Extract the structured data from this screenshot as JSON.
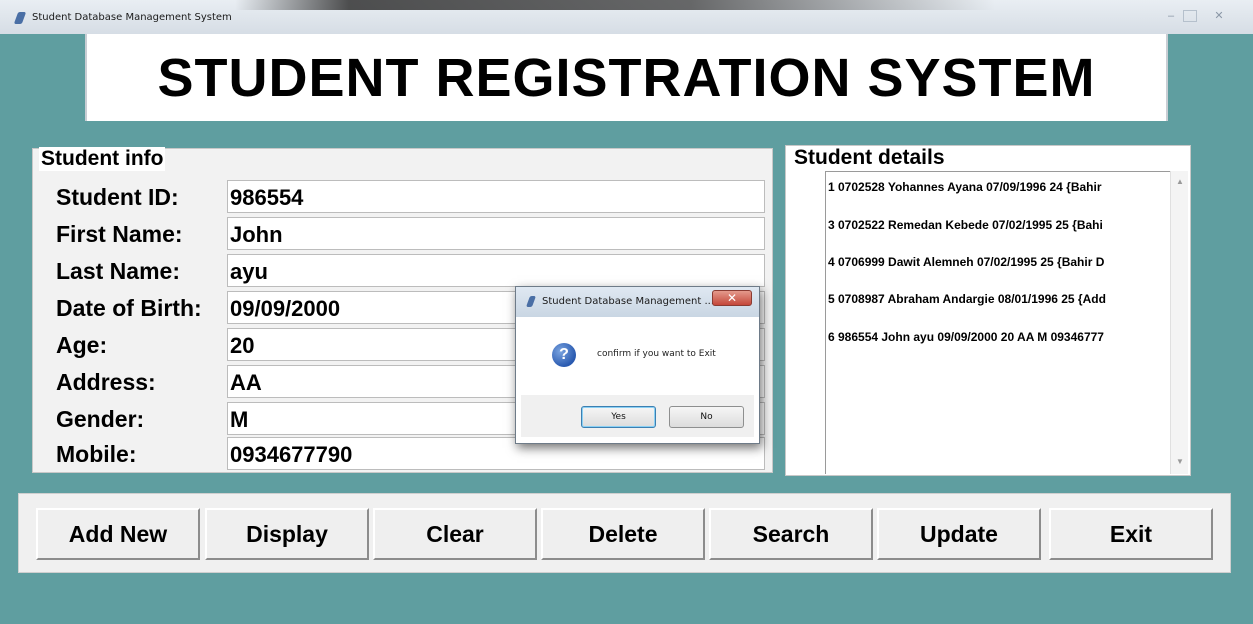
{
  "window": {
    "title": "Student Database Management System",
    "minimize": "–",
    "maximize": "▫",
    "close": "✕"
  },
  "banner": {
    "title": "STUDENT REGISTRATION SYSTEM"
  },
  "student_info": {
    "label": "Student info",
    "fields": [
      {
        "label": "Student ID:",
        "value": "986554"
      },
      {
        "label": "First Name:",
        "value": "John"
      },
      {
        "label": "Last Name:",
        "value": "ayu"
      },
      {
        "label": "Date of Birth:",
        "value": "09/09/2000"
      },
      {
        "label": "Age:",
        "value": "20"
      },
      {
        "label": "Address:",
        "value": "AA"
      },
      {
        "label": "Gender:",
        "value": "M"
      },
      {
        "label": "Mobile:",
        "value": "0934677790"
      }
    ]
  },
  "student_details": {
    "label": "Student details",
    "records": [
      "1 0702528 Yohannes Ayana 07/09/1996 24 {Bahir",
      "3 0702522 Remedan Kebede 07/02/1995 25 {Bahi",
      "4 0706999 Dawit Alemneh 07/02/1995 25 {Bahir D",
      "5 0708987 Abraham Andargie 08/01/1996 25 {Add",
      "6 986554 John ayu 09/09/2000 20 AA M 09346777"
    ],
    "scroll_up": "▲",
    "scroll_down": "▼"
  },
  "buttons": {
    "add_new": "Add New",
    "display": "Display",
    "clear": "Clear",
    "delete": "Delete",
    "search": "Search",
    "update": "Update",
    "exit": "Exit"
  },
  "dialog": {
    "title": "Student Database Management ...",
    "close": "✕",
    "icon": "?",
    "message": "confirm if you want to Exit",
    "yes": "Yes",
    "no": "No"
  },
  "colors": {
    "background": "#5f9ea0",
    "panel": "#f0f0f0",
    "accent_close": "#c4473a"
  }
}
